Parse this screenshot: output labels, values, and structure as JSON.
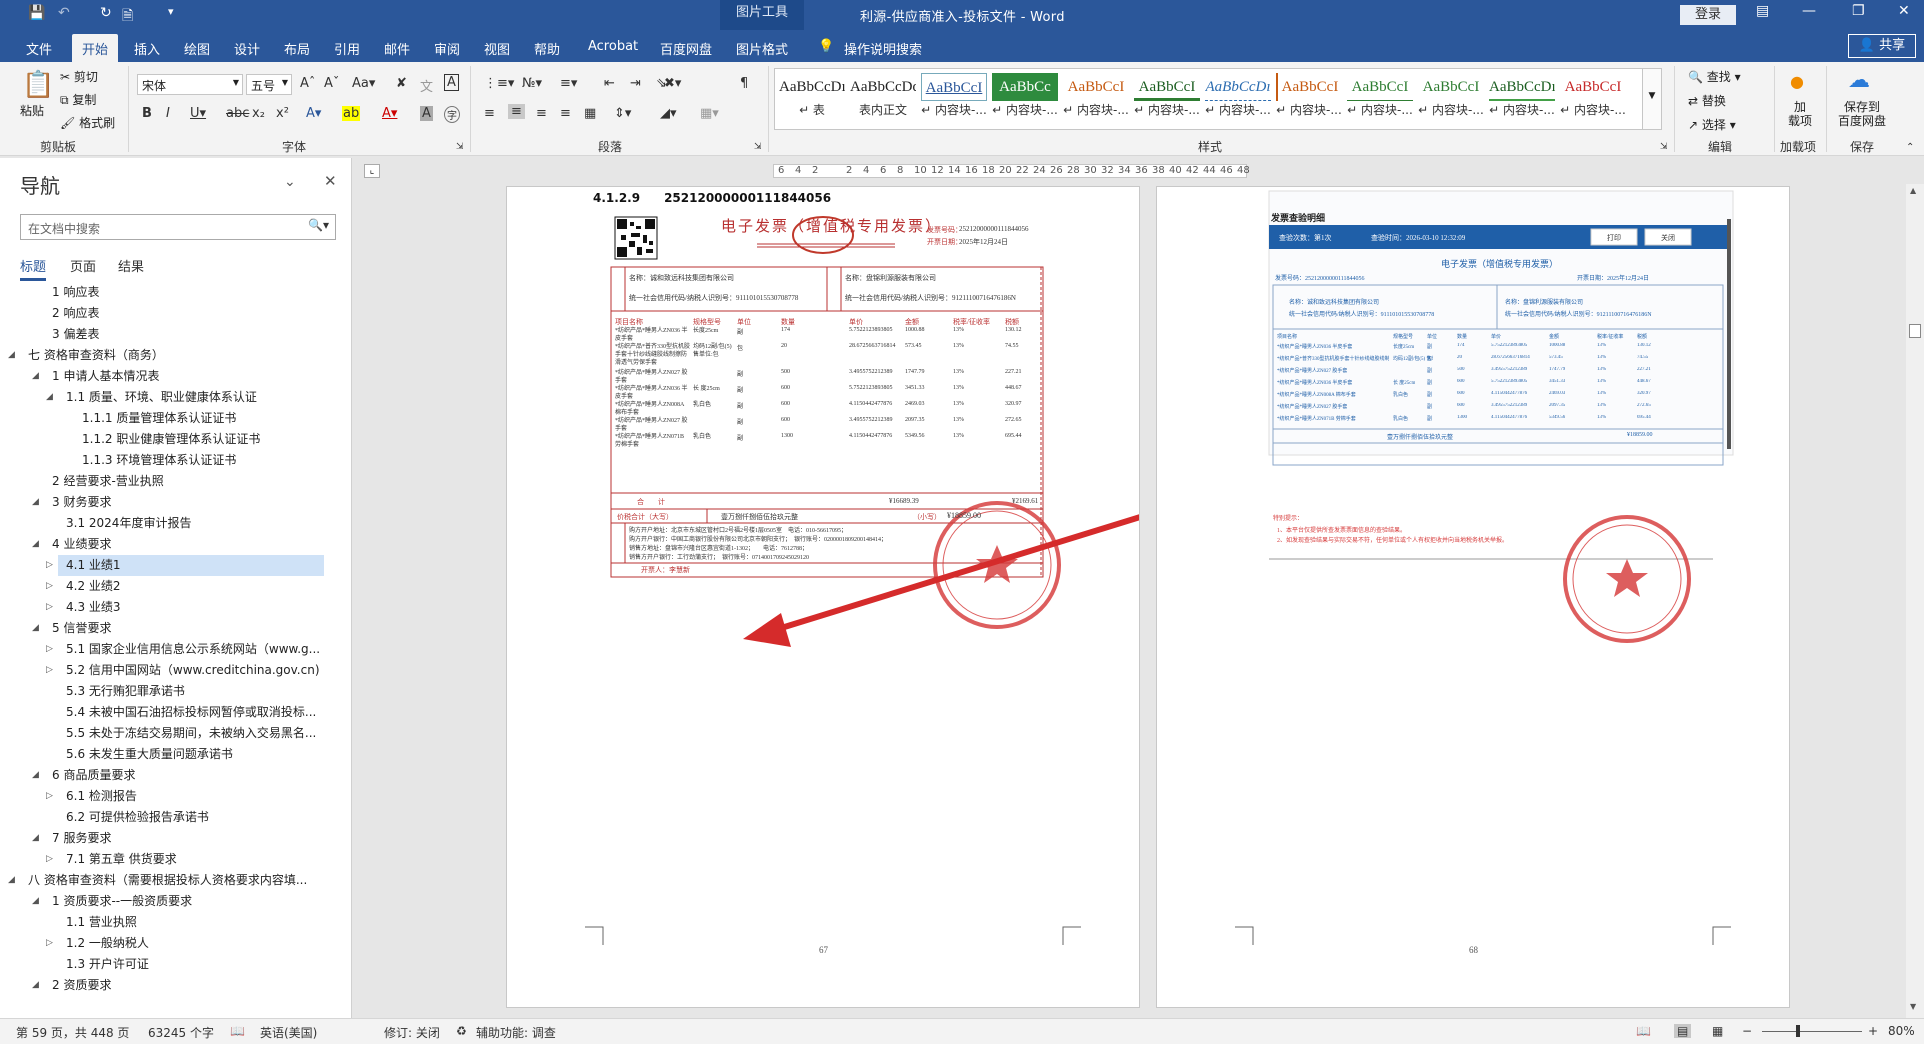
{
  "window": {
    "title": "利源-供应商准入-投标文件 - Word",
    "context_tab_group": "图片工具",
    "login_label": "登录"
  },
  "tabs": [
    "文件",
    "开始",
    "插入",
    "绘图",
    "设计",
    "布局",
    "引用",
    "邮件",
    "审阅",
    "视图",
    "帮助",
    "Acrobat",
    "百度网盘",
    "图片格式"
  ],
  "tell_me": "操作说明搜索",
  "share_label": "共享",
  "ribbon": {
    "clipboard": {
      "paste": "粘贴",
      "cut": "剪切",
      "copy": "复制",
      "format_painter": "格式刷",
      "group_label": "剪贴板"
    },
    "font": {
      "font_name": "宋体",
      "font_size": "五号",
      "group_label": "字体"
    },
    "paragraph": {
      "group_label": "段落"
    },
    "styles": {
      "group_label": "样式",
      "items": [
        {
          "sample": "AaBbCcDı",
          "name": "↵ 表"
        },
        {
          "sample": "AaBbCcDdI",
          "name": "表内正文"
        },
        {
          "sample": "AaBbCcI",
          "name": "↵ 内容块-..."
        },
        {
          "sample": "AaBbCc",
          "name": "↵ 内容块-..."
        },
        {
          "sample": "AaBbCcI",
          "name": "↵ 内容块-..."
        },
        {
          "sample": "AaBbCcI",
          "name": "↵ 内容块-..."
        },
        {
          "sample": "AaBbCcDı",
          "name": "↵ 内容块-..."
        },
        {
          "sample": "AaBbCcI",
          "name": "↵ 内容块-..."
        },
        {
          "sample": "AaBbCcI",
          "name": "↵ 内容块-..."
        },
        {
          "sample": "AaBbCcI",
          "name": "↵ 内容块-..."
        },
        {
          "sample": "AaBbCcDı",
          "name": "↵ 内容块-..."
        },
        {
          "sample": "AaBbCcI",
          "name": "↵ 内容块-..."
        }
      ]
    },
    "editing": {
      "find": "查找",
      "replace": "替换",
      "select": "选择",
      "group_label": "编辑"
    },
    "addins": {
      "label": "加\n载项",
      "group_label": "加载项"
    },
    "save_cloud": {
      "label": "保存到\n百度网盘",
      "group_label": "保存"
    }
  },
  "nav": {
    "title": "导航",
    "search_placeholder": "在文档中搜索",
    "tabs": [
      "标题",
      "页面",
      "结果"
    ],
    "items": [
      {
        "level": 2,
        "text": "1 响应表",
        "arrow": false
      },
      {
        "level": 2,
        "text": "2 响应表",
        "arrow": false
      },
      {
        "level": 2,
        "text": "3 偏差表",
        "arrow": false
      },
      {
        "level": 1,
        "text": "七 资格审查资料（商务）",
        "arrow": "open"
      },
      {
        "level": 2,
        "text": "1 申请人基本情况表",
        "arrow": "open"
      },
      {
        "level": 3,
        "text": "1.1 质量、环境、职业健康体系认证",
        "arrow": "open"
      },
      {
        "level": 4,
        "text": "1.1.1 质量管理体系认证证书",
        "arrow": false
      },
      {
        "level": 4,
        "text": "1.1.2 职业健康管理体系认证证书",
        "arrow": false
      },
      {
        "level": 4,
        "text": "1.1.3 环境管理体系认证证书",
        "arrow": false
      },
      {
        "level": 2,
        "text": "2 经营要求-营业执照",
        "arrow": false
      },
      {
        "level": 2,
        "text": "3 财务要求",
        "arrow": "open"
      },
      {
        "level": 3,
        "text": "3.1 2024年度审计报告",
        "arrow": false
      },
      {
        "level": 2,
        "text": "4 业绩要求",
        "arrow": "open"
      },
      {
        "level": 3,
        "text": "4.1 业绩1",
        "arrow": "closed",
        "selected": true
      },
      {
        "level": 3,
        "text": "4.2 业绩2",
        "arrow": "closed"
      },
      {
        "level": 3,
        "text": "4.3 业绩3",
        "arrow": "closed"
      },
      {
        "level": 2,
        "text": "5 信誉要求",
        "arrow": "open"
      },
      {
        "level": 3,
        "text": "5.1 国家企业信用信息公示系统网站（www.g...",
        "arrow": "closed"
      },
      {
        "level": 3,
        "text": "5.2 信用中国网站（www.creditchina.gov.cn)",
        "arrow": "closed"
      },
      {
        "level": 3,
        "text": "5.3 无行贿犯罪承诺书",
        "arrow": false
      },
      {
        "level": 3,
        "text": "5.4 未被中国石油招标投标网暂停或取消投标...",
        "arrow": false
      },
      {
        "level": 3,
        "text": "5.5 未处于冻结交易期间，未被纳入交易黑名...",
        "arrow": false
      },
      {
        "level": 3,
        "text": "5.6 未发生重大质量问题承诺书",
        "arrow": false
      },
      {
        "level": 2,
        "text": "6 商品质量要求",
        "arrow": "open"
      },
      {
        "level": 3,
        "text": "6.1 检测报告",
        "arrow": "closed"
      },
      {
        "level": 3,
        "text": "6.2 可提供检验报告承诺书",
        "arrow": false
      },
      {
        "level": 2,
        "text": "7 服务要求",
        "arrow": "open"
      },
      {
        "level": 3,
        "text": "7.1 第五章 供货要求",
        "arrow": "closed"
      },
      {
        "level": 1,
        "text": "八 资格审查资料（需要根据投标人资格要求内容填...",
        "arrow": "open"
      },
      {
        "level": 2,
        "text": "1 资质要求--一般资质要求",
        "arrow": "open"
      },
      {
        "level": 3,
        "text": "1.1 营业执照",
        "arrow": false
      },
      {
        "level": 3,
        "text": "1.2 一般纳税人",
        "arrow": "closed"
      },
      {
        "level": 3,
        "text": "1.3 开户许可证",
        "arrow": false
      },
      {
        "level": 2,
        "text": "2 资质要求",
        "arrow": "open"
      }
    ]
  },
  "ruler_ticks": [
    "6",
    "4",
    "2",
    "",
    "2",
    "4",
    "6",
    "8",
    "10",
    "12",
    "14",
    "16",
    "18",
    "20",
    "22",
    "24",
    "26",
    "28",
    "30",
    "32",
    "34",
    "36",
    "38",
    "40",
    "42",
    "44",
    "46",
    "48"
  ],
  "page_left": {
    "heading": "4.1.2.9　　252120000001118440​56",
    "invoice_title": "电子发票（增值税专用发票）",
    "invoice_no_label": "发票号码：",
    "invoice_no": "25212000000111844056",
    "invoice_date_label": "开票日期：",
    "invoice_date": "2025年12月24日",
    "buyer_name": "名称：诚和致远科技集团有限公司",
    "buyer_tax": "统一社会信用代码/纳税人识别号：911101015530708778",
    "seller_name": "名称：盘锦利源服装有限公司",
    "seller_tax": "统一社会信用代码/纳税人识别号：91211100716476186N",
    "headers": [
      "项目名称",
      "规格型号",
      "单位",
      "数量",
      "单价",
      "金额",
      "税率/征收率",
      "税额"
    ],
    "rows": [
      [
        "*纺织产品*睡男人ZN036 半皮手套",
        "长度25cm",
        "副",
        "174",
        "5.7522123893805",
        "1000.88",
        "13%",
        "130.12"
      ],
      [
        "*纺织产品*普齐330型抗机胶手套十针纱线缝胶线制擦防滑透气劳保手套",
        "均码12副/包(5) 售单位:包",
        "包",
        "20",
        "28.6725663716814",
        "573.45",
        "13%",
        "74.55"
      ],
      [
        "*纺织产品*睡男人ZN027 胶手套",
        "",
        "副",
        "500",
        "3.4955752212389",
        "1747.79",
        "13%",
        "227.21"
      ],
      [
        "*纺织产品*睡男人ZN036 半皮手套",
        "长 度25cm",
        "副",
        "600",
        "5.7522123893805",
        "3451.33",
        "13%",
        "448.67"
      ],
      [
        "*纺织产品*睡男人ZN008A 棉布手套",
        "乳白色",
        "副",
        "600",
        "4.1150442477876",
        "2469.03",
        "13%",
        "320.97"
      ],
      [
        "*纺织产品*睡男人ZN027 胶手套",
        "",
        "副",
        "600",
        "3.4955752212389",
        "2097.35",
        "13%",
        "272.65"
      ],
      [
        "*纺织产品*睡男人ZN071B 劳棉手套",
        "乳白色",
        "副",
        "1300",
        "4.1150442477876",
        "5349.56",
        "13%",
        "695.44"
      ]
    ],
    "total_label": "合　　计",
    "total_amount": "¥16689.39",
    "total_tax": "¥2169.61",
    "grand_label": "价税合计（大写）",
    "grand_words": "壹万捌仟捌佰伍拾玖元整",
    "grand_small_label": "（小写）",
    "grand_small": "¥18859.00",
    "note_lines": [
      "购方开户地址：北京市东城区管村口2号福2号楼1层0505室　电话：010-56617095；",
      "购方开户银行：中国工商银行股份有限公司北京市朝阳支行；　银行账号：0200001809200148414；",
      "销售方地址：盘锦市兴隆台区惠宜街道1-1302；　　电话：7612788；",
      "销售方开户银行：工行劲蒲支行；　银行账号：0714001709245029120"
    ],
    "issuer": "开票人：李慧新",
    "seal_text": "盘锦利源服装有限公司",
    "page_number": "67"
  },
  "page_right": {
    "window_title": "发票查验明细",
    "check_count": "查验次数：第1次",
    "check_time": "查验时间：2026-03-10 12:32:09",
    "print_btn": "打印",
    "close_btn": "关闭",
    "invoice_title": "电子发票（增值税专用发票）",
    "invoice_no": "发票号码：25212000000111844056",
    "invoice_date": "开票日期：2025年12月24日",
    "buyer_name": "名称：诚和致远科技集团有限公司",
    "buyer_tax": "统一社会信用代码/纳税人识别号：911101015530708778",
    "seller_name": "名称：盘锦利源服装有限公司",
    "seller_tax": "统一社会信用代码/纳税人识别号：91211100716476186N",
    "grand_words": "壹万捌仟捌佰伍拾玖元整",
    "grand_small": "¥18859.00",
    "tips_title": "特别提示：",
    "tips": [
      "1、本平台仅提供所查发票票面信息的查验结果。",
      "2、如发现查验结果与实际交易不符，任何单位或个人有权拒收并向当地税务机关举报。"
    ],
    "seal_text": "盘锦利源服装有限公司",
    "page_number": "68"
  },
  "status": {
    "page": "第 59 页，共 448 页",
    "words": "63245 个字",
    "lang": "英语(美国)",
    "track": "修订: 关闭",
    "access": "辅助功能: 调查",
    "zoom": "80%"
  },
  "colors": {
    "word_blue": "#2b579a",
    "seal_red": "#d63b3b",
    "arrow_red": "#d52b2b",
    "invoice_red": "#b83030",
    "verify_blue": "#1f5fa8"
  }
}
